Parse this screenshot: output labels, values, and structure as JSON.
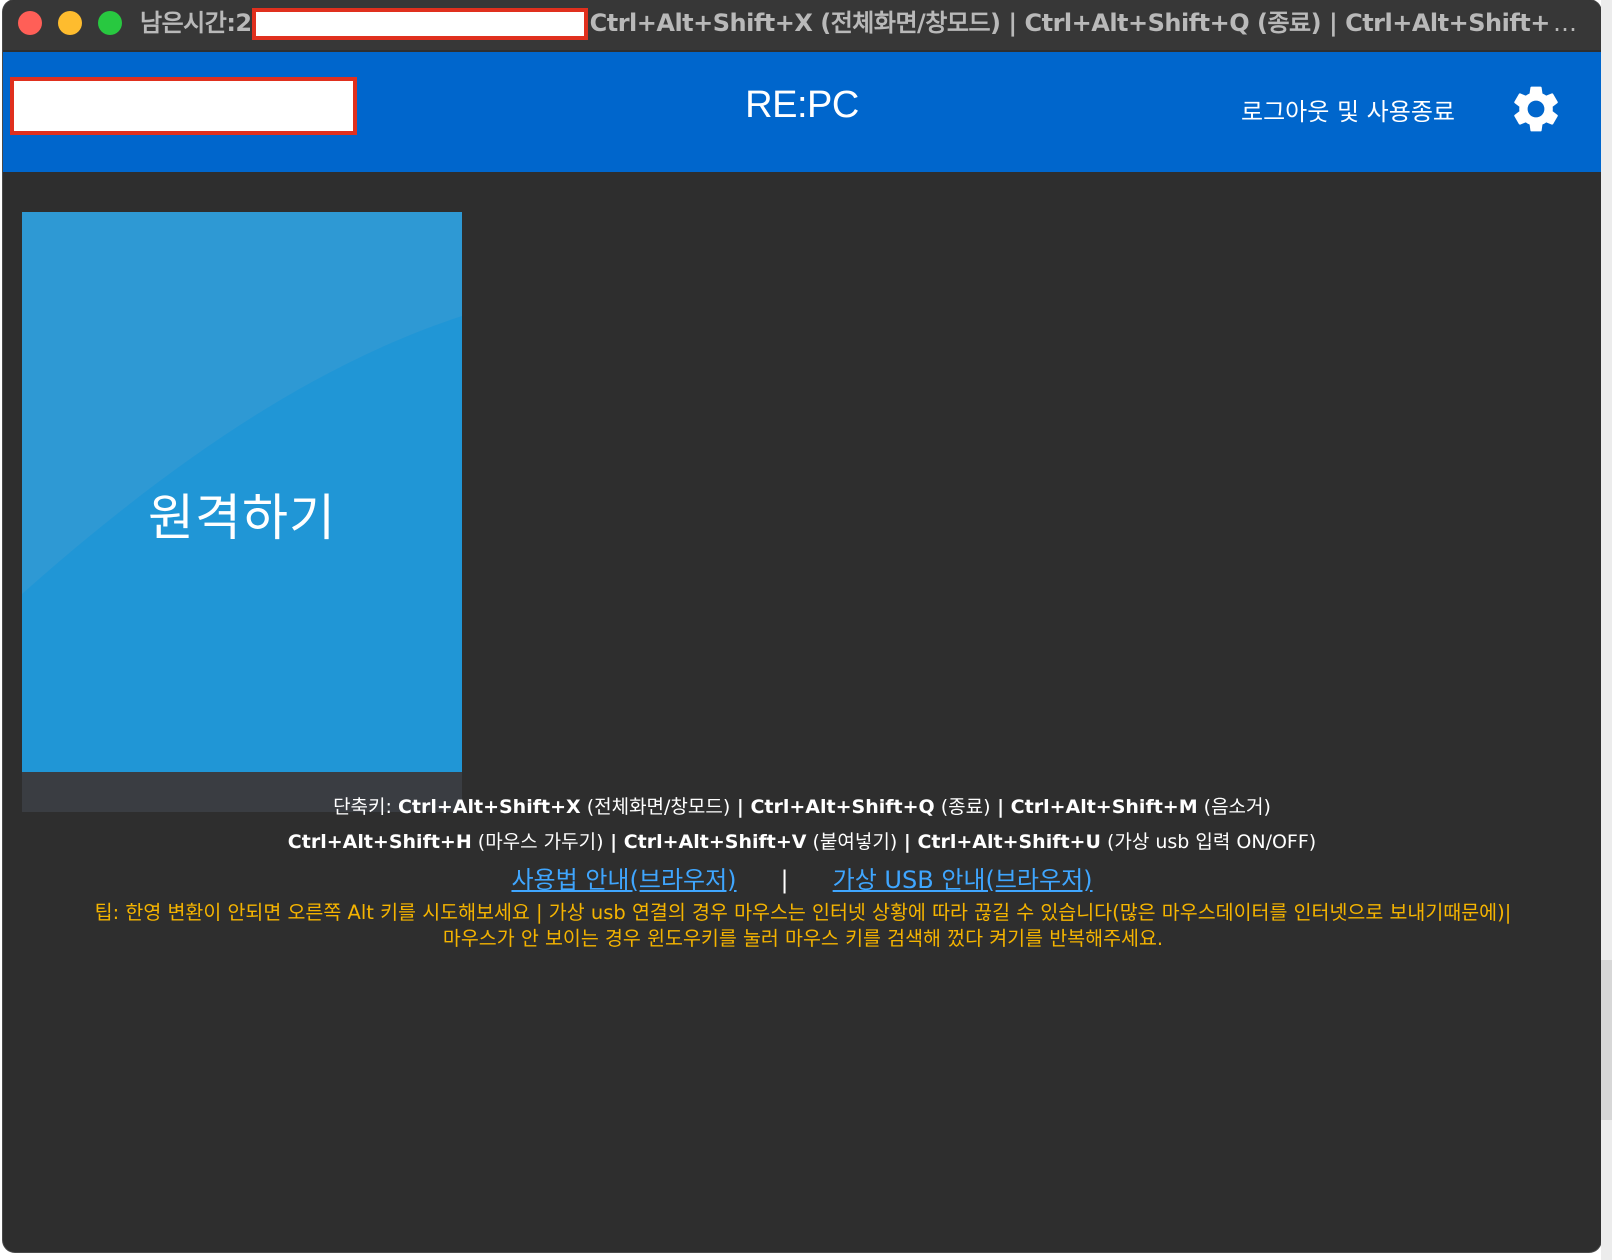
{
  "titlebar": {
    "prefix": "남은시간:2",
    "shortcuts": "Ctrl+Alt+Shift+X (전체화면/창모드) | Ctrl+Alt+Shift+Q (종료) | Ctrl+Alt+Shift+M (",
    "ellipsis": "…"
  },
  "header": {
    "title": "RE:PC",
    "logout_label": "로그아웃 및 사용종료",
    "settings_icon": "gear-icon"
  },
  "tile": {
    "label": "원격하기"
  },
  "shortcuts": {
    "line1": {
      "prefix": "단축키: ",
      "items": [
        {
          "key": "Ctrl+Alt+Shift+X",
          "desc": " (전체화면/창모드)"
        },
        {
          "key": "Ctrl+Alt+Shift+Q",
          "desc": " (종료)"
        },
        {
          "key": "Ctrl+Alt+Shift+M",
          "desc": " (음소거)"
        }
      ]
    },
    "line2": {
      "items": [
        {
          "key": "Ctrl+Alt+Shift+H",
          "desc": " (마우스 가두기)"
        },
        {
          "key": "Ctrl+Alt+Shift+V",
          "desc": " (붙여넣기)"
        },
        {
          "key": "Ctrl+Alt+Shift+U",
          "desc": " (가상 usb 입력 ON/OFF)"
        }
      ]
    },
    "separator": " | "
  },
  "links": {
    "usage_guide": "사용법 안내(브라우저)",
    "separator": "|",
    "usb_guide": "가상 USB 안내(브라우저)"
  },
  "tip": {
    "line1": "팁: 한영 변환이 안되면 오른쪽 Alt 키를 시도해보세요 | 가상 usb 연결의 경우 마우스는 인터넷 상황에 따라 끊길 수 있습니다(많은 마우스데이터를 인터넷으로 보내기때문에)|",
    "line2": "마우스가 안 보이는 경우 윈도우키를 눌러 마우스 키를 검색해 껐다 켜기를 반복해주세요."
  },
  "colors": {
    "header_bg": "#0066cc",
    "tile_bg": "#2096d6",
    "link": "#3fa6ff",
    "tip": "#f5b400",
    "background": "#2e2e2e"
  }
}
